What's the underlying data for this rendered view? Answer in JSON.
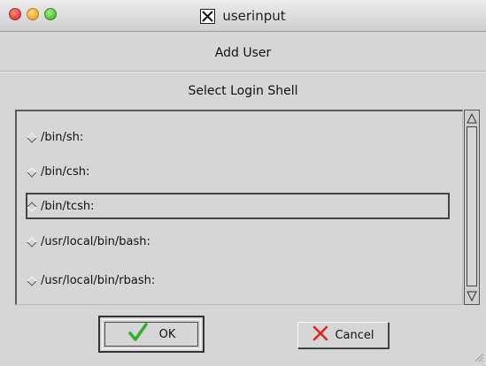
{
  "window": {
    "title": "userinput",
    "icon": "x11-icon",
    "controls": [
      "close-icon",
      "minimize-icon",
      "zoom-icon"
    ]
  },
  "dialog": {
    "heading": "Add User",
    "prompt": "Select Login Shell"
  },
  "shells": [
    {
      "label": "/bin/sh:",
      "selected": false
    },
    {
      "label": "/bin/csh:",
      "selected": false
    },
    {
      "label": "/bin/tcsh:",
      "selected": true
    },
    {
      "label": "/usr/local/bin/bash:",
      "selected": false
    },
    {
      "label": "/usr/local/bin/rbash:",
      "selected": false
    }
  ],
  "buttons": {
    "ok_label": "OK",
    "ok_icon": "checkmark-icon",
    "cancel_label": "Cancel",
    "cancel_icon": "x-cross-icon"
  },
  "colors": {
    "ok_check": "#2fb02f",
    "cancel_x": "#e02020",
    "background": "#d6d6d6"
  }
}
